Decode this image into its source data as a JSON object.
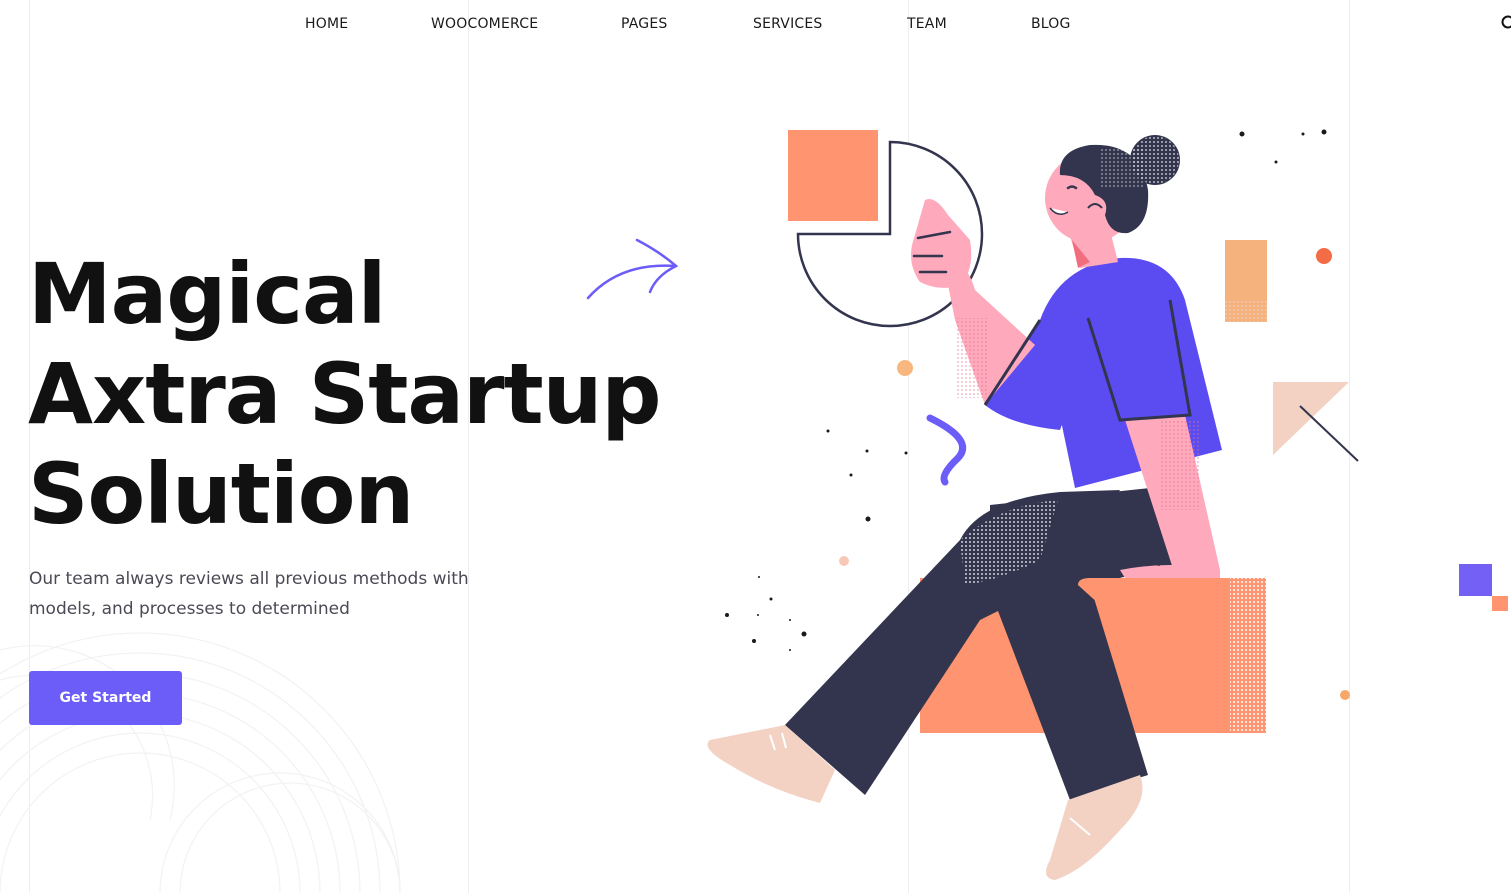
{
  "nav": {
    "items": [
      {
        "label": "HOME"
      },
      {
        "label": "WOOCOMERCE"
      },
      {
        "label": "PAGES"
      },
      {
        "label": "SERVICES"
      },
      {
        "label": "TEAM"
      },
      {
        "label": "BLOG"
      }
    ],
    "search_icon": "search-icon"
  },
  "hero": {
    "title_lines": [
      "Magical",
      "Axtra Startup",
      "Solution"
    ],
    "subtitle": "Our team always reviews all previous methods with models, and processes to determined",
    "cta_label": "Get Started"
  },
  "colors": {
    "accent": "#6c5cf8",
    "orange": "#ff9470",
    "navy": "#32354d",
    "skin": "#ffa9bd",
    "shirt": "#5b4cf2"
  }
}
